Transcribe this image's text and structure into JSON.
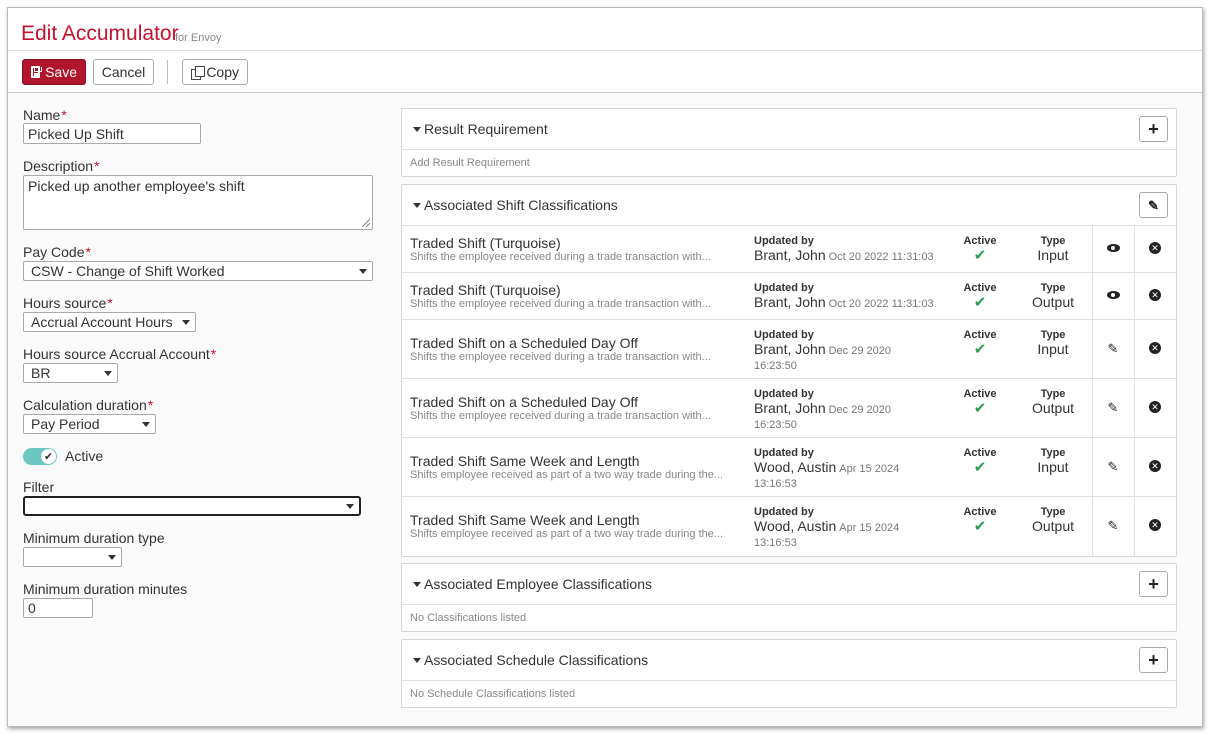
{
  "header": {
    "title": "Edit Accumulator",
    "subtitle": "for Envoy"
  },
  "toolbar": {
    "save_label": "Save",
    "cancel_label": "Cancel",
    "copy_label": "Copy"
  },
  "form": {
    "name_label": "Name",
    "name_value": "Picked Up Shift",
    "description_label": "Description",
    "description_value": "Picked up another employee's shift",
    "pay_code_label": "Pay Code",
    "pay_code_value": "CSW - Change of Shift Worked",
    "hours_source_label": "Hours source",
    "hours_source_value": "Accrual Account Hours",
    "hours_source_account_label": "Hours source Accrual Account",
    "hours_source_account_value": "BR",
    "calc_duration_label": "Calculation duration",
    "calc_duration_value": "Pay Period",
    "active_label": "Active",
    "filter_label": "Filter",
    "filter_value": "",
    "min_duration_type_label": "Minimum duration type",
    "min_duration_type_value": "",
    "min_duration_minutes_label": "Minimum duration minutes",
    "min_duration_minutes_value": "0",
    "required_mark": "*"
  },
  "result_requirement": {
    "title": "Result Requirement",
    "empty_text": "Add Result Requirement"
  },
  "shift_classifications": {
    "title": "Associated Shift Classifications",
    "updated_by_label": "Updated by",
    "active_label": "Active",
    "type_label": "Type",
    "active_mark": "✔",
    "rows": [
      {
        "name": "Traded Shift (Turquoise)",
        "desc": "Shifts the employee received during a trade transaction with...",
        "user": "Brant, John",
        "date": "Oct 20 2022 11:31:03",
        "date2": "",
        "type": "Input",
        "action_icon": "eye-icon"
      },
      {
        "name": "Traded Shift (Turquoise)",
        "desc": "Shifts the employee received during a trade transaction with...",
        "user": "Brant, John",
        "date": "Oct 20 2022 11:31:03",
        "date2": "",
        "type": "Output",
        "action_icon": "eye-icon"
      },
      {
        "name": "Traded Shift on a Scheduled Day Off",
        "desc": "Shifts the employee received during a trade transaction with...",
        "user": "Brant, John",
        "date": "Dec 29 2020",
        "date2": "16:23:50",
        "type": "Input",
        "action_icon": "pencil-icon"
      },
      {
        "name": "Traded Shift on a Scheduled Day Off",
        "desc": "Shifts the employee received during a trade transaction with...",
        "user": "Brant, John",
        "date": "Dec 29 2020",
        "date2": "16:23:50",
        "type": "Output",
        "action_icon": "pencil-icon"
      },
      {
        "name": "Traded Shift Same Week and Length",
        "desc": "Shifts employee received as part of a two way trade during the...",
        "user": "Wood, Austin",
        "date": "Apr 15 2024",
        "date2": "13:16:53",
        "type": "Input",
        "action_icon": "pencil-icon"
      },
      {
        "name": "Traded Shift Same Week and Length",
        "desc": "Shifts employee received as part of a two way trade during the...",
        "user": "Wood, Austin",
        "date": "Apr 15 2024",
        "date2": "13:16:53",
        "type": "Output",
        "action_icon": "pencil-icon"
      }
    ]
  },
  "employee_classifications": {
    "title": "Associated Employee Classifications",
    "empty_text": "No Classifications listed"
  },
  "schedule_classifications": {
    "title": "Associated Schedule Classifications",
    "empty_text": "No Schedule Classifications listed"
  },
  "icons": {
    "plus": "+",
    "pencil": "✎",
    "remove": "✕",
    "check": "✔"
  },
  "colors": {
    "brand_red": "#c8102e",
    "save_button": "#b0152b",
    "toggle": "#6cc7c3",
    "check_green": "#2e9d56"
  }
}
